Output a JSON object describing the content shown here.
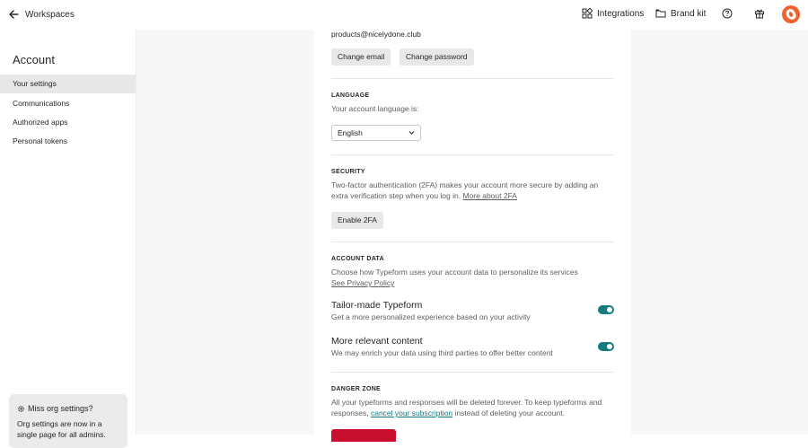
{
  "topbar": {
    "workspaces_label": "Workspaces",
    "integrations_label": "Integrations",
    "brand_kit_label": "Brand kit"
  },
  "sidebar": {
    "title": "Account",
    "items": [
      {
        "label": "Your settings",
        "active": true
      },
      {
        "label": "Communications"
      },
      {
        "label": "Authorized apps"
      },
      {
        "label": "Personal tokens"
      }
    ],
    "notice": {
      "title": "Miss org settings?",
      "body": "Org settings are now in a single page for all admins."
    }
  },
  "main": {
    "email": "products@nicelydone.club",
    "change_email_label": "Change email",
    "change_password_label": "Change password",
    "language": {
      "heading": "LANGUAGE",
      "description": "Your account language is:",
      "selected": "English"
    },
    "security": {
      "heading": "SECURITY",
      "description_1": "Two-factor authentication (2FA) makes your account more secure by adding an",
      "description_2": "extra verification step when you log in.",
      "link": "More about 2FA",
      "button": "Enable 2FA"
    },
    "account_data": {
      "heading": "ACCOUNT DATA",
      "description": "Choose how Typeform uses your account data to personalize its services",
      "link": "See Privacy Policy",
      "options": [
        {
          "title": "Tailor-made Typeform",
          "description": "Get a more personalized experience based on your activity",
          "enabled": true
        },
        {
          "title": "More relevant content",
          "description": "We may enrich your data using third parties to offer better content",
          "enabled": true
        }
      ]
    },
    "danger_zone": {
      "heading": "DANGER ZONE",
      "description_1": "All your typeforms and responses will be deleted forever. To keep typeforms and",
      "description_2_pre": "responses,",
      "link": "cancel your subscription",
      "description_2_post": "instead of deleting your account."
    }
  },
  "colors": {
    "accent_toggle": "#147c80",
    "danger": "#c8102e",
    "avatar": "#f0612d",
    "active_item": "#e8e8e8"
  },
  "icons": [
    "back-arrow-icon",
    "integrations-icon",
    "brand-kit-icon",
    "help-icon",
    "gift-icon",
    "gear-icon",
    "chevron-down-icon"
  ]
}
